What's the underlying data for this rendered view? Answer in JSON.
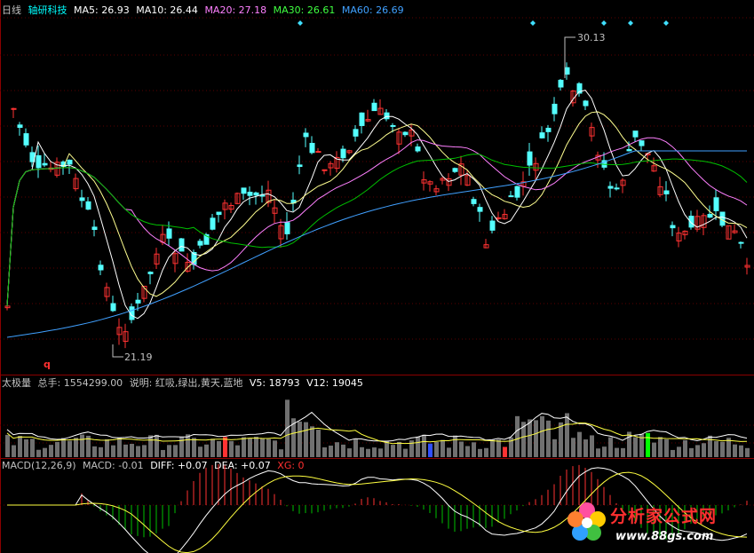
{
  "main": {
    "period": "日线",
    "stock": "轴研科技",
    "ma": [
      {
        "label": "MA5: 26.93",
        "color": "#ffffff"
      },
      {
        "label": "MA10: 26.44",
        "color": "#ffffff"
      },
      {
        "label": "MA20: 27.18",
        "color": "#ff80ff"
      },
      {
        "label": "MA30: 26.61",
        "color": "#00ff00"
      },
      {
        "label": "MA60: 26.69",
        "color": "#00ffff"
      }
    ],
    "high_label": "30.13",
    "low_label": "21.19",
    "marker_q": "q"
  },
  "volume": {
    "title": "太极量",
    "total": "总手: 1554299.00",
    "note": "说明: 红吸,绿出,黄天,蓝地",
    "v5": "V5: 18793",
    "v12": "V12: 19045"
  },
  "macd": {
    "title": "MACD(12,26,9)",
    "macd": "MACD: -0.01",
    "diff": "DIFF: +0.07",
    "dea": "DEA: +0.07",
    "xg": "XG: 0"
  },
  "watermark": {
    "title": "分析家公式网",
    "url": "www.88gs.com"
  },
  "colors": {
    "up": "#ff3232",
    "down": "#54ffff",
    "ma20": "#ff80ff",
    "ma30": "#00c000",
    "ma60": "#3070ff",
    "yellow": "#ffff00"
  }
}
